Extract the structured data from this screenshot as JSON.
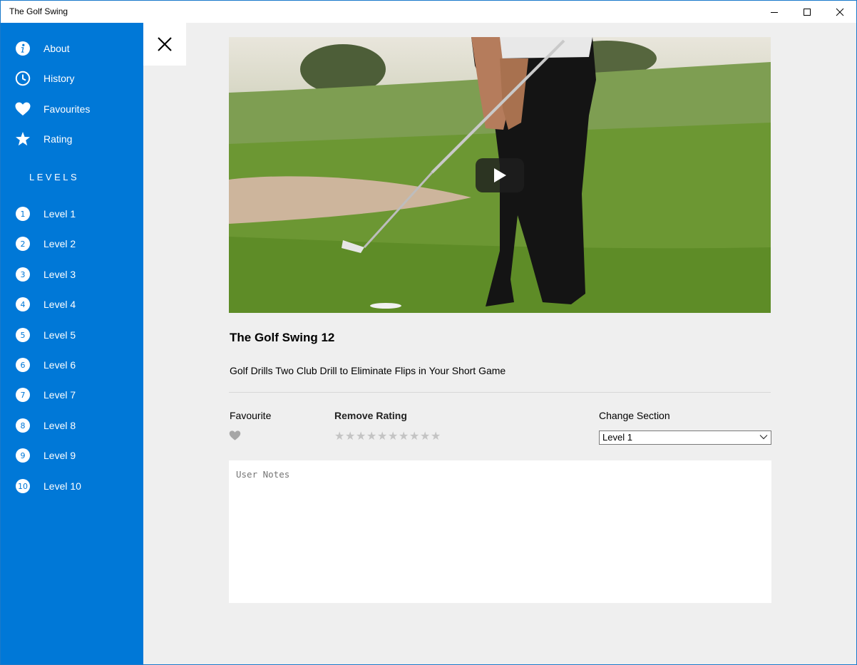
{
  "window": {
    "title": "The Golf Swing"
  },
  "sidebar": {
    "accent_color": "#0078d7",
    "items": [
      {
        "label": "About",
        "icon": "info-icon"
      },
      {
        "label": "History",
        "icon": "clock-icon"
      },
      {
        "label": "Favourites",
        "icon": "heart-icon"
      },
      {
        "label": "Rating",
        "icon": "star-icon"
      }
    ],
    "levels_heading": "LEVELS",
    "levels": [
      {
        "num": "1",
        "label": "Level 1"
      },
      {
        "num": "2",
        "label": "Level 2"
      },
      {
        "num": "3",
        "label": "Level 3"
      },
      {
        "num": "4",
        "label": "Level 4"
      },
      {
        "num": "5",
        "label": "Level 5"
      },
      {
        "num": "6",
        "label": "Level 6"
      },
      {
        "num": "7",
        "label": "Level 7"
      },
      {
        "num": "8",
        "label": "Level 8"
      },
      {
        "num": "9",
        "label": "Level 9"
      },
      {
        "num": "10",
        "label": "Level 10"
      }
    ]
  },
  "main": {
    "video": {
      "play_icon": "play-icon"
    },
    "title": "The Golf Swing 12",
    "description": "Golf Drills Two Club Drill to Eliminate Flips in Your Short Game",
    "favourite_label": "Favourite",
    "rating": {
      "label": "Remove Rating",
      "stars_total": 10,
      "stars_filled": 0
    },
    "section": {
      "label": "Change Section",
      "selected": "Level 1"
    },
    "notes": {
      "placeholder": "User Notes"
    }
  }
}
